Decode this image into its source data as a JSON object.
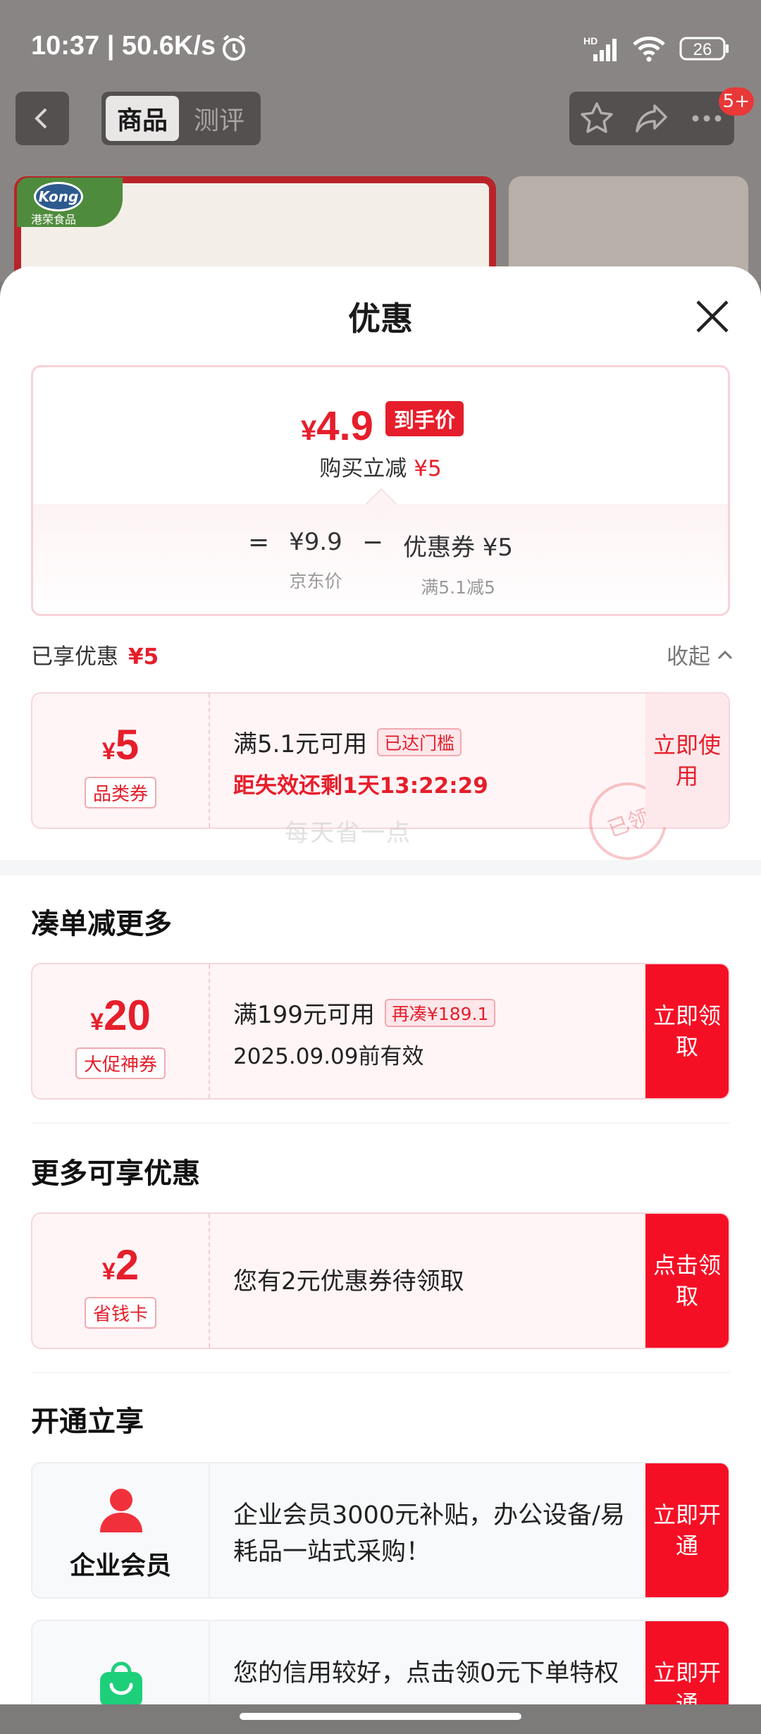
{
  "status_bar": {
    "time": "10:37 | 50.6K/s",
    "battery": "26",
    "network": "HD"
  },
  "top_nav": {
    "tabs": [
      "商品",
      "测评"
    ],
    "badge": "5+"
  },
  "background": {
    "logo_text": "Kong",
    "logo_sub": "港荣食品"
  },
  "sheet": {
    "title": "优惠",
    "price_card": {
      "currency": "¥",
      "final_price": "4.9",
      "final_tag": "到手价",
      "reduce_label": "购买立减",
      "reduce_value": "¥5",
      "equals": "=",
      "jd_price": "¥9.9",
      "jd_price_label": "京东价",
      "minus": "−",
      "coupon_value": "优惠券 ¥5",
      "coupon_rule": "满5.1减5"
    },
    "enjoyed": {
      "label": "已享优惠",
      "value": "¥5",
      "collapse": "收起"
    },
    "claimed_coupon": {
      "currency": "¥",
      "amount": "5",
      "kind": "品类券",
      "condition": "满5.1元可用",
      "chip": "已达门槛",
      "countdown": "距失效还剩1天13:22:29",
      "action": "立即使用",
      "stamp": "已领"
    },
    "watermark": "每天省一点",
    "section_more": {
      "title": "凑单减更多",
      "coupon": {
        "currency": "¥",
        "amount": "20",
        "kind": "大促神券",
        "condition": "满199元可用",
        "chip": "再凑¥189.1",
        "expiry": "2025.09.09前有效",
        "action": "立即领取"
      }
    },
    "section_extra": {
      "title": "更多可享优惠",
      "coupon": {
        "currency": "¥",
        "amount": "2",
        "kind": "省钱卡",
        "text": "您有2元优惠券待领取",
        "action": "点击领取"
      }
    },
    "section_open": {
      "title": "开通立享",
      "items": [
        {
          "label": "企业会员",
          "icon": "person-icon",
          "text": " 企业会员3000元补贴，办公设备/易耗品一站式采购！",
          "action": "立即开通"
        },
        {
          "label": "",
          "icon": "shopping-bag-icon",
          "text": "您的信用较好，点击领0元下单特权",
          "action": "立即开通"
        }
      ]
    }
  },
  "colors": {
    "accent": "#e61e2b",
    "button": "#f50f25",
    "coupon_bg": "#fff5f6",
    "bag_green": "#1ecf7a"
  }
}
